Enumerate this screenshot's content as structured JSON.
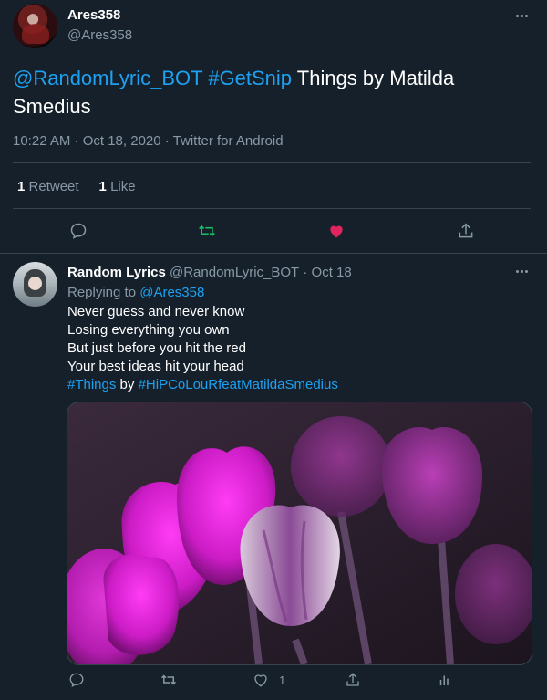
{
  "main_tweet": {
    "author": {
      "name": "Ares358",
      "handle": "@Ares358"
    },
    "text": {
      "mention": "@RandomLyric_BOT",
      "hashtag": "#GetSnip",
      "rest": "Things by Matilda Smedius"
    },
    "meta": "10:22 AM · Oct 18, 2020 · Twitter for Android",
    "stats": {
      "retweets": "1",
      "retweets_label": "Retweet",
      "likes": "1",
      "likes_label": "Like"
    },
    "actions": {
      "reply": "reply-icon",
      "retweet": "retweet-icon",
      "like": "heart-filled-icon",
      "share": "share-icon"
    },
    "colors": {
      "retweet_active": "#17bf63",
      "like_active": "#e0245e"
    }
  },
  "reply": {
    "author": {
      "name": "Random Lyrics",
      "handle": "@RandomLyric_BOT",
      "date": "Oct 18"
    },
    "replying_prefix": "Replying to",
    "replying_to": "@Ares358",
    "lines": [
      "Never guess and never know",
      "Losing everything you own",
      "But just before you hit the red",
      "Your best ideas hit your head"
    ],
    "tags": {
      "tag1": "#Things",
      "by": "by",
      "tag2": "#HiPCoLouRfeatMatildaSmedius"
    },
    "media": {
      "description_icon": "tulip-photo"
    },
    "actions": {
      "like_count": "1"
    }
  },
  "colors": {
    "background": "#15202b",
    "link": "#1da1f2",
    "muted": "#8899a6",
    "divider": "#38444d"
  }
}
